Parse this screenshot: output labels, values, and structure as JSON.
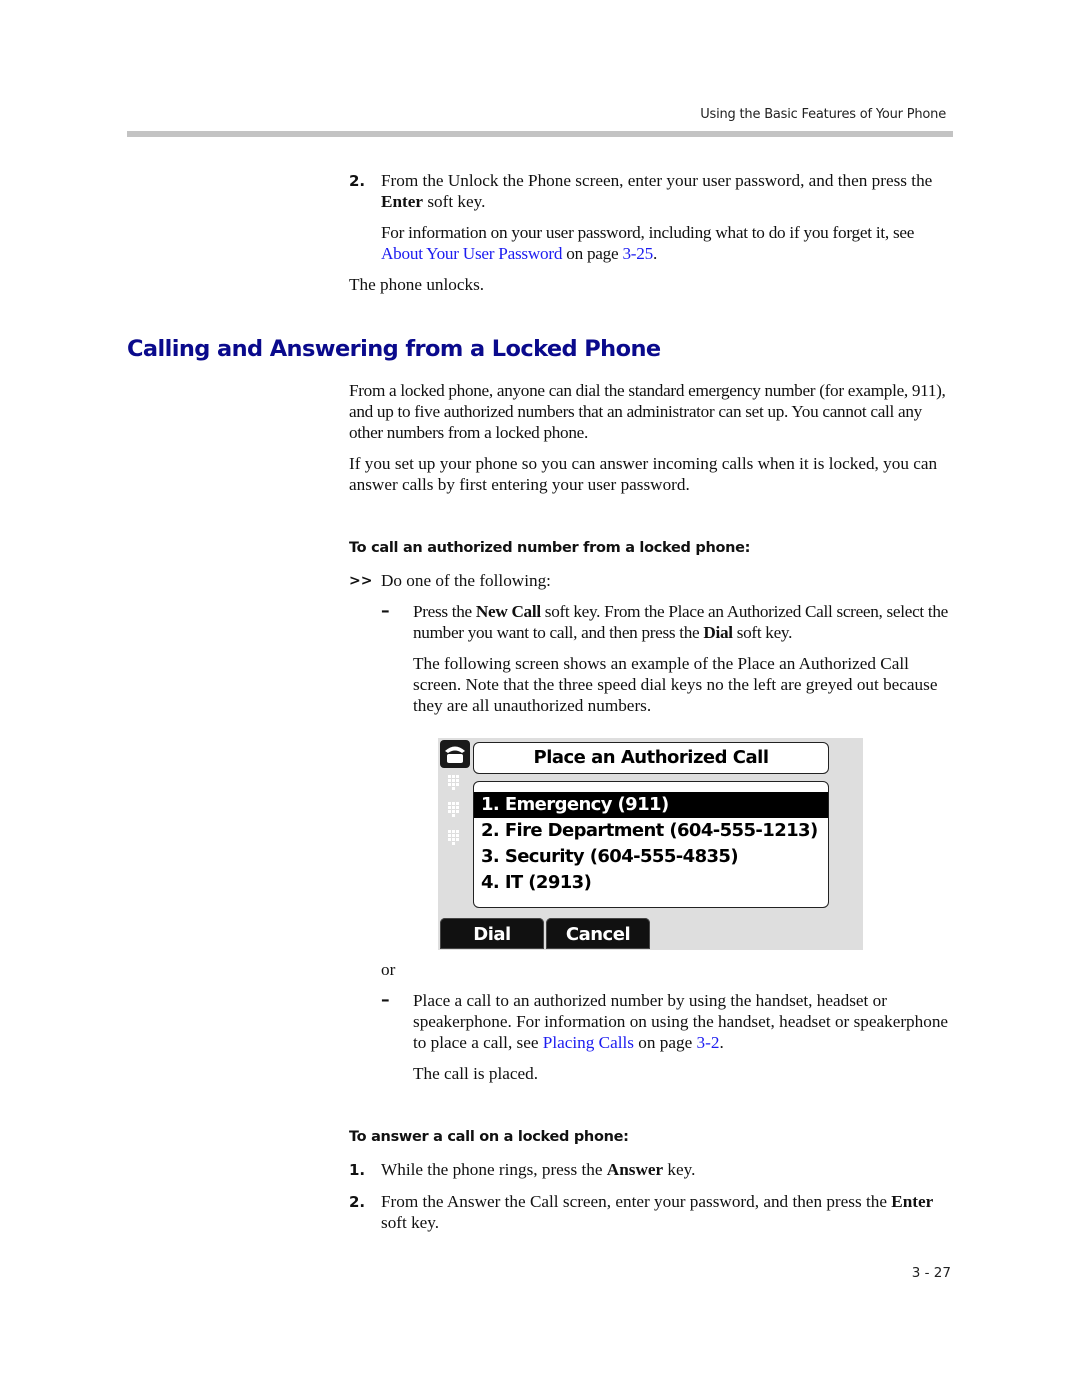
{
  "header": {
    "running_head": "Using the Basic Features of Your Phone"
  },
  "step_unlock": {
    "number": "2.",
    "text_before": "From the Unlock the Phone screen, enter your user password, and then press the ",
    "bold": "Enter",
    "text_after": " soft key.",
    "info_before": "For information on your user password, including what to do if you forget it, see ",
    "info_link": "About Your User Password",
    "info_mid": " on page ",
    "info_page_link": "3-25",
    "info_end": ".",
    "result": "The phone unlocks."
  },
  "section": {
    "title": "Calling and Answering from a Locked Phone",
    "para1": "From a locked phone, anyone can dial the standard emergency number (for example, 911), and up to five authorized numbers that an administrator can set up. You cannot call any other numbers from a locked phone.",
    "para2": "If you set up your phone so you can answer incoming calls when it is locked, you can answer calls by first entering your user password."
  },
  "procedure_call": {
    "heading": "To call an authorized number from a locked phone:",
    "marker": ">>",
    "intro": "Do one of the following:",
    "option1": {
      "dash": "–",
      "t1": "Press the ",
      "b1": "New Call",
      "t2": " soft key. From the Place an Authorized Call screen, select the number you want to call, and then press the ",
      "b2": "Dial",
      "t3": " soft key.",
      "note": "The following screen shows an example of the Place an Authorized Call screen. Note that the three speed dial keys no the left are greyed out because they are all unauthorized numbers."
    },
    "or_text": "or",
    "option2": {
      "dash": "–",
      "t1": "Place a call to an authorized number by using the handset, headset or speakerphone. For information on using the handset, headset or speakerphone to place a call, see ",
      "link": "Placing Calls",
      "t2": " on page ",
      "page_link": "3-2",
      "t3": ".",
      "result": "The call is placed."
    }
  },
  "phone_screen": {
    "title": "Place an Authorized Call",
    "line_icon": "phone-handset-icon",
    "speed_dial_icons": [
      "speed-dial-icon",
      "speed-dial-icon",
      "speed-dial-icon"
    ],
    "items": [
      "1. Emergency (911)",
      "2. Fire Department (604-555-1213)",
      "3. Security (604-555-4835)",
      "4. IT (2913)"
    ],
    "selected_index": 0,
    "softkeys": [
      "Dial",
      "Cancel"
    ]
  },
  "procedure_answer": {
    "heading": "To answer a call on a locked phone:",
    "step1": {
      "number": "1.",
      "t1": "While the phone rings, press the ",
      "b": "Answer",
      "t2": " key."
    },
    "step2": {
      "number": "2.",
      "t1": "From the Answer the Call screen, enter your password, and then press the ",
      "b": "Enter",
      "t2": " soft key."
    }
  },
  "footer": {
    "page_number": "3 - 27"
  },
  "colors": {
    "heading": "#0a0a8c",
    "link": "#1c1cf0",
    "rule": "#c3c3c3"
  }
}
